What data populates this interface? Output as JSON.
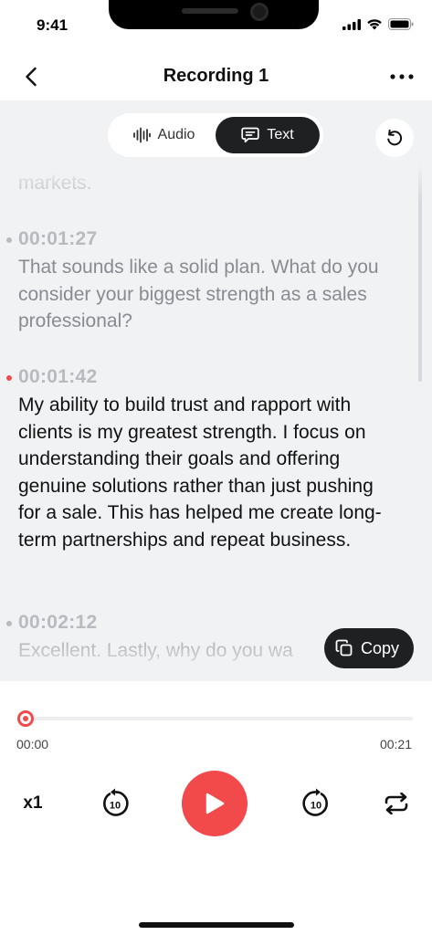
{
  "status_bar": {
    "time": "9:41"
  },
  "nav": {
    "title": "Recording 1"
  },
  "segment": {
    "audio_label": "Audio",
    "text_label": "Text",
    "selected": "Text"
  },
  "transcript": {
    "partial_top": "markets.",
    "entries": [
      {
        "time": "00:01:27",
        "text": "That sounds like a solid plan. What do you consider your biggest strength as a sales professional?"
      },
      {
        "time": "00:01:42",
        "text": "My ability to build trust and rapport with clients is my greatest strength. I focus on understanding their goals and offering genuine solutions rather than just pushing for a sale. This has helped me create long-term partnerships and repeat business."
      },
      {
        "time": "00:02:12",
        "text": "Excellent. Lastly, why do you wa"
      }
    ]
  },
  "copy": {
    "label": "Copy"
  },
  "player": {
    "current_time": "00:00",
    "total_time": "00:21",
    "progress": 0,
    "speed": "x1",
    "skip_seconds": "10"
  },
  "colors": {
    "accent": "#f24a4a",
    "dark": "#1f2022",
    "panel": "#f1f2f4"
  }
}
